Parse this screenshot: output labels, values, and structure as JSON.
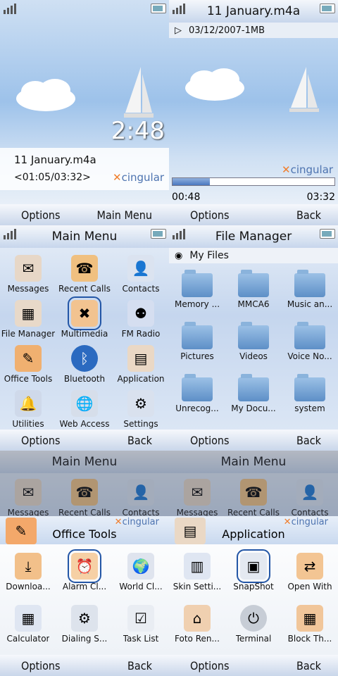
{
  "screens": {
    "home": {
      "track": "11 January.m4a",
      "time_progress": "<01:05/03:32>",
      "clock": "2:48",
      "brand": "cingular",
      "soft_left": "Options",
      "soft_right": "Main Menu"
    },
    "player": {
      "title": "11 January.m4a",
      "info": "03/12/2007-1MB",
      "brand": "cingular",
      "elapsed": "00:48",
      "total": "03:32",
      "progress": 0.23,
      "soft_left": "Options",
      "soft_right": "Back"
    },
    "main_menu": {
      "title": "Main Menu",
      "items": [
        "Messages",
        "Recent Calls",
        "Contacts",
        "File Manager",
        "Multimedia",
        "FM Radio",
        "Office Tools",
        "Bluetooth",
        "Application",
        "Utilities",
        "Web Access",
        "Settings"
      ],
      "soft_left": "Options",
      "soft_right": "Back"
    },
    "file_manager": {
      "title": "File Manager",
      "location": "My Files",
      "items": [
        "Memory ...",
        "MMCA6",
        "Music an...",
        "Pictures",
        "Videos",
        "Voice No...",
        "Unrecog...",
        "My Docu...",
        "system"
      ],
      "soft_left": "Options",
      "soft_right": "Back"
    },
    "office_tools": {
      "bg_title": "Main Menu",
      "bg_items": [
        "Messages",
        "Recent Calls",
        "Contacts"
      ],
      "title": "Office Tools",
      "brand": "cingular",
      "items": [
        "Downloa...",
        "Alarm Cl...",
        "World Cl...",
        "Calculator",
        "Dialing S...",
        "Task List"
      ],
      "soft_left": "Options",
      "soft_right": "Back"
    },
    "application": {
      "bg_title": "Main Menu",
      "bg_items": [
        "Messages",
        "Recent Calls",
        "Contacts"
      ],
      "title": "Application",
      "brand": "cingular",
      "items": [
        "Skin Setti...",
        "SnapShot",
        "Open With",
        "Foto Ren...",
        "Terminal",
        "Block Th..."
      ],
      "soft_left": "Options",
      "soft_right": "Back"
    }
  }
}
